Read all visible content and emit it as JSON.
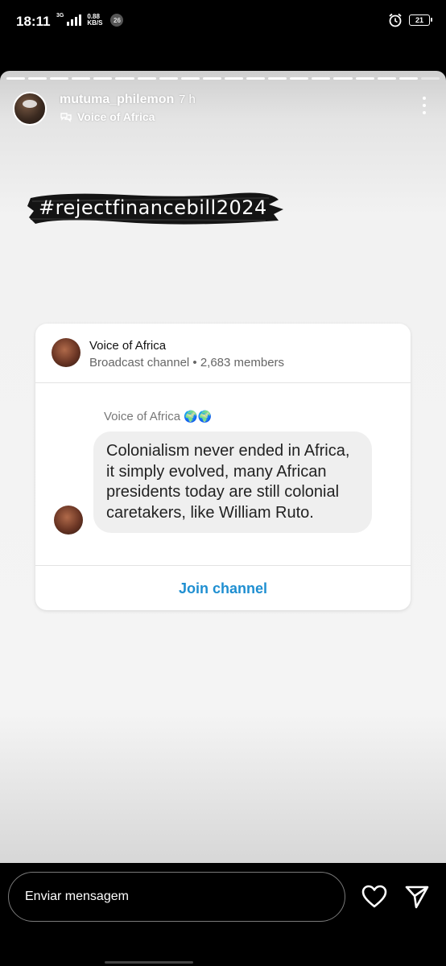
{
  "status_bar": {
    "time": "18:11",
    "network_type": "3G",
    "speed_value": "0.88",
    "speed_unit": "KB/S",
    "notification_count": "26",
    "battery_level": "21"
  },
  "story": {
    "username": "mutuma_philemon",
    "time_ago": "7 h",
    "source_label": "Voice of Africa",
    "hashtag": "#rejectfinancebill2024"
  },
  "channel_card": {
    "channel_name": "Voice of Africa",
    "channel_subtitle": "Broadcast channel • 2,683 members",
    "sender_name": "Voice of Africa",
    "sender_emoji": "🌍🌍",
    "message_text": "Colonialism never ended in Africa, it simply evolved, many African presidents today are still colonial caretakers,  like William Ruto.",
    "join_label": "Join channel"
  },
  "bottom_bar": {
    "message_placeholder": "Enviar mensagem"
  },
  "colors": {
    "accent_link": "#1f8fd1",
    "story_background": "#f4f4f4",
    "bubble": "#efefef"
  },
  "icons": [
    "alarm-icon",
    "signal-icon",
    "battery-icon",
    "channel-icon",
    "more-icon",
    "heart-icon",
    "send-icon",
    "globe-emoji"
  ]
}
